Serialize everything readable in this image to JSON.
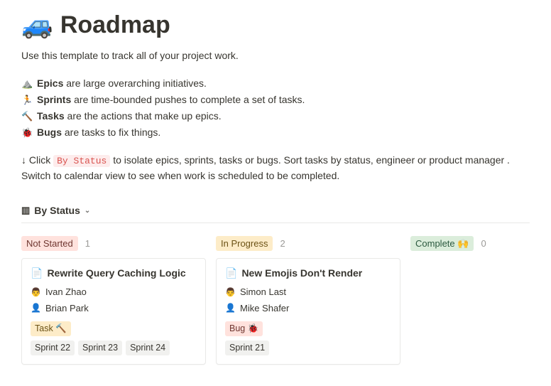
{
  "header": {
    "emoji": "🚙",
    "title": "Roadmap",
    "subtitle": "Use this template to track all of your project work."
  },
  "legend": [
    {
      "icon": "⛰️",
      "name": "Epics",
      "desc": " are large overarching initiatives."
    },
    {
      "icon": "🏃",
      "name": "Sprints",
      "desc": " are time-bounded pushes to complete a set of tasks."
    },
    {
      "icon": "🔨",
      "name": "Tasks",
      "desc": " are the actions that make up epics."
    },
    {
      "icon": "🐞",
      "name": "Bugs",
      "desc": " are tasks to fix things."
    }
  ],
  "hint": {
    "prefix": "↓ Click ",
    "code": "By Status",
    "suffix": " to isolate epics, sprints, tasks or bugs. Sort tasks by status, engineer or product manager . Switch to calendar view to see when work is scheduled to be completed."
  },
  "view": {
    "icon": "▥",
    "label": "By Status",
    "chevron": "⌄"
  },
  "columns": {
    "not_started": {
      "label": "Not Started",
      "count": "1",
      "card": {
        "title": "Rewrite Query Caching Logic",
        "people": [
          {
            "avatar": "👨",
            "name": "Ivan Zhao"
          },
          {
            "avatar": "👤",
            "name": "Brian Park"
          }
        ],
        "type_label": "Task 🔨",
        "sprints": [
          "Sprint 22",
          "Sprint 23",
          "Sprint 24"
        ]
      }
    },
    "in_progress": {
      "label": "In Progress",
      "count": "2",
      "card": {
        "title": "New Emojis Don't Render",
        "people": [
          {
            "avatar": "👨",
            "name": "Simon Last"
          },
          {
            "avatar": "👤",
            "name": "Mike Shafer"
          }
        ],
        "type_label": "Bug 🐞",
        "sprints": [
          "Sprint 21"
        ]
      }
    },
    "complete": {
      "label": "Complete 🙌",
      "count": "0"
    }
  }
}
